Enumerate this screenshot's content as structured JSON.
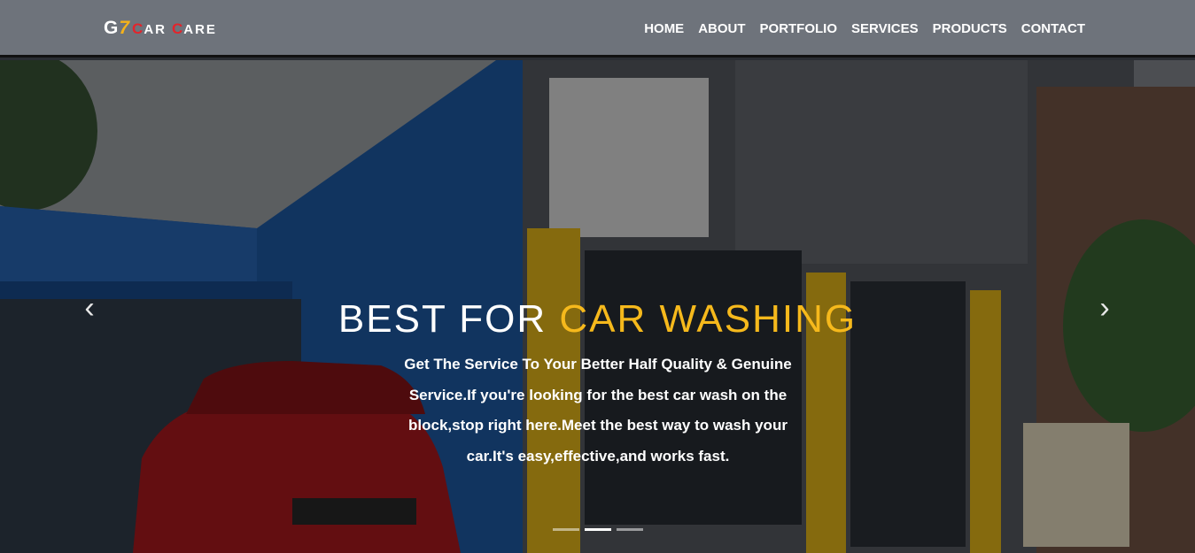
{
  "brand": {
    "g": "G",
    "seven": "7",
    "car_initial": "C",
    "car_rest": "AR",
    "care_initial": "C",
    "care_rest": "ARE"
  },
  "nav": {
    "items": [
      "HOME",
      "ABOUT",
      "PORTFOLIO",
      "SERVICES",
      "PRODUCTS",
      "CONTACT"
    ]
  },
  "hero": {
    "headline_white": "BEST FOR",
    "headline_accent": "CAR WASHING",
    "description": "Get The Service To Your Better Half Quality & Genuine Service.If you're looking for the best car wash on the block,stop right here.Meet the best way to wash your car.It's easy,effective,and works fast.",
    "prev_arrow": "‹",
    "next_arrow": "›",
    "slide_count": 3,
    "active_slide": 2
  },
  "colors": {
    "navbar_bg": "#6e737b",
    "accent": "#f6b91c",
    "brand_red": "#e3242b"
  }
}
